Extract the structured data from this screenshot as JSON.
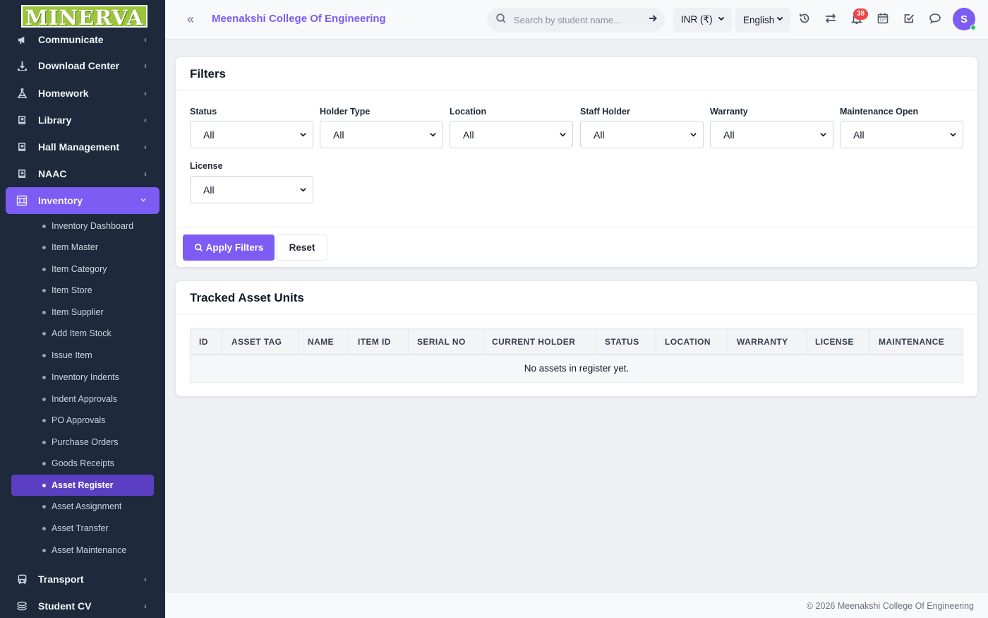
{
  "brand": {
    "logo_text": "MINERVA"
  },
  "sidebar": {
    "items": [
      {
        "label": "Communicate",
        "icon": "megaphone-icon"
      },
      {
        "label": "Download Center",
        "icon": "download-icon"
      },
      {
        "label": "Homework",
        "icon": "flask-icon"
      },
      {
        "label": "Library",
        "icon": "book-icon"
      },
      {
        "label": "Hall Management",
        "icon": "book-icon"
      },
      {
        "label": "NAAC",
        "icon": "book-icon"
      },
      {
        "label": "Inventory",
        "icon": "inventory-icon",
        "expanded": true
      },
      {
        "label": "Transport",
        "icon": "bus-icon"
      },
      {
        "label": "Student CV",
        "icon": "layers-icon"
      }
    ],
    "inventory_sub": [
      "Inventory Dashboard",
      "Item Master",
      "Item Category",
      "Item Store",
      "Item Supplier",
      "Add Item Stock",
      "Issue Item",
      "Inventory Indents",
      "Indent Approvals",
      "PO Approvals",
      "Purchase Orders",
      "Goods Receipts",
      "Asset Register",
      "Asset Assignment",
      "Asset Transfer",
      "Asset Maintenance"
    ],
    "active_sub": "Asset Register"
  },
  "header": {
    "college_name": "Meenakshi College Of Engineering",
    "search_placeholder": "Search by student name...",
    "currency": "INR (₹)",
    "language": "English",
    "notification_count": "38",
    "avatar_initial": "S"
  },
  "filters": {
    "title": "Filters",
    "fields": [
      {
        "label": "Status",
        "value": "All"
      },
      {
        "label": "Holder Type",
        "value": "All"
      },
      {
        "label": "Location",
        "value": "All"
      },
      {
        "label": "Staff Holder",
        "value": "All"
      },
      {
        "label": "Warranty",
        "value": "All"
      },
      {
        "label": "Maintenance Open",
        "value": "All"
      },
      {
        "label": "License",
        "value": "All"
      }
    ],
    "apply_label": "Apply Filters",
    "reset_label": "Reset"
  },
  "assets": {
    "title": "Tracked Asset Units",
    "columns": [
      "ID",
      "ASSET TAG",
      "NAME",
      "ITEM ID",
      "SERIAL NO",
      "CURRENT HOLDER",
      "STATUS",
      "LOCATION",
      "WARRANTY",
      "LICENSE",
      "MAINTENANCE"
    ],
    "empty_message": "No assets in register yet."
  },
  "footer": {
    "text": "© 2026 Meenakshi College Of Engineering"
  },
  "colors": {
    "accent": "#7c5cf2",
    "sidebar_bg": "#1e293b",
    "active_sub_bg": "#5b3fc2",
    "badge": "#ef4444"
  }
}
